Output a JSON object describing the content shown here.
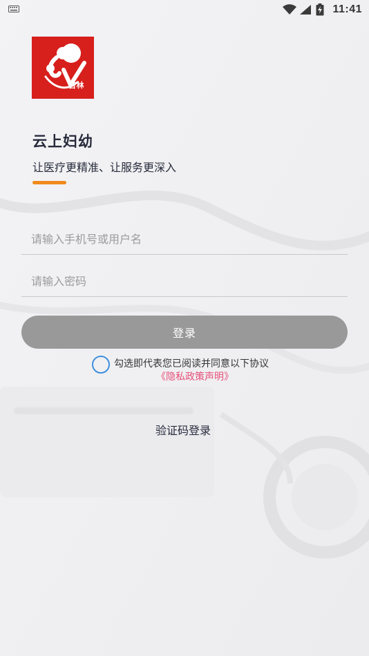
{
  "status_bar": {
    "time": "11:41",
    "icons": [
      "keyboard-icon",
      "wifi-icon",
      "signal-icon",
      "battery-charging-icon"
    ]
  },
  "logo": {
    "badge_text": "吉林",
    "icon": "mother-baby-logo-icon",
    "color": "#d71f1c"
  },
  "app": {
    "title": "云上妇幼",
    "slogan": "让医疗更精准、让服务更深入",
    "accent_color": "#f08a1c"
  },
  "form": {
    "phone_placeholder": "请输入手机号或用户名",
    "phone_value": "",
    "password_placeholder": "请输入密码",
    "password_value": "",
    "login_label": "登录",
    "login_color": "#999999"
  },
  "agreement": {
    "checked": false,
    "text": "勾选即代表您已阅读并同意以下协议",
    "privacy_link": "《隐私政策声明》",
    "link_color": "#e8507a",
    "check_color": "#3f8fde"
  },
  "alt_login": {
    "sms_label": "验证码登录"
  }
}
